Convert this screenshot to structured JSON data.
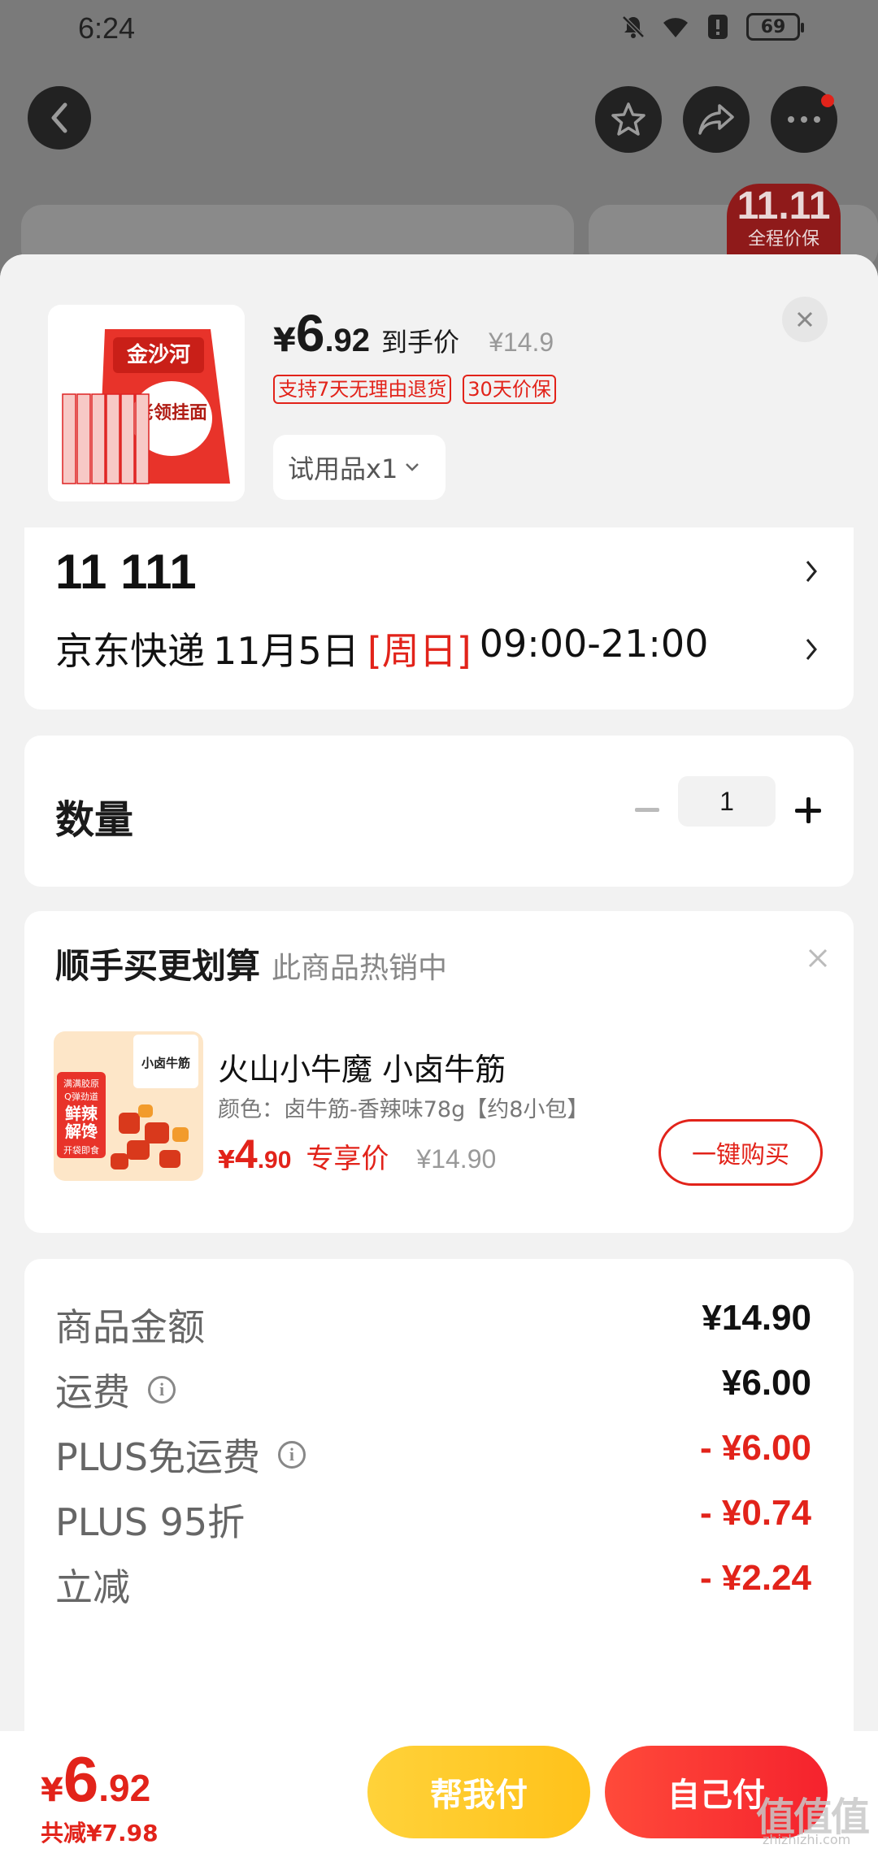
{
  "status_bar": {
    "time": "6:24",
    "battery": "69"
  },
  "background": {
    "banner_big": "11.11",
    "banner_small": "全程价保"
  },
  "product": {
    "price_yen": "¥",
    "price_int": "6",
    "price_dec": ".92",
    "price_label": "到手价",
    "original_price": "¥14.9",
    "tags": [
      "支持7天无理由退货",
      "30天价保"
    ],
    "variant": "试用品x1",
    "image_brand": "金沙河",
    "image_text": "老领挂面"
  },
  "address": {
    "line": "11  111",
    "carrier": "京东快递",
    "date": "11月5日",
    "day": "[周日]",
    "time_window": "09:00-21:00"
  },
  "quantity": {
    "label": "数量",
    "value": "1",
    "minus": "−",
    "plus": "+"
  },
  "upsell": {
    "title": "顺手买更划算",
    "subtitle": "此商品热销中",
    "name": "火山小牛魔 小卤牛筋",
    "spec": "颜色：卤牛筋-香辣味78g【约8小包】",
    "price_yen": "¥",
    "price_int": "4",
    "price_dec": ".90",
    "price_label": "专享价",
    "original_price": "¥14.90",
    "buy_button": "一键购买",
    "image_label": "小卤牛筋",
    "image_tags": [
      "满满胶原",
      "Q弹劲道",
      "鲜辣",
      "解馋",
      "开袋即食"
    ]
  },
  "summary": {
    "rows": [
      {
        "label": "商品金额",
        "value": "¥14.90",
        "info": false,
        "red": false
      },
      {
        "label": "运费",
        "value": "¥6.00",
        "info": true,
        "red": false
      },
      {
        "label": "PLUS免运费",
        "value": "- ¥6.00",
        "info": true,
        "red": true
      },
      {
        "label": "PLUS 95折",
        "value": "- ¥0.74",
        "info": false,
        "red": true
      },
      {
        "label": "立减",
        "value": "- ¥2.24",
        "info": false,
        "red": true
      }
    ]
  },
  "bottom": {
    "total_yen": "¥",
    "total_int": "6",
    "total_dec": ".92",
    "saved": "共减¥7.98",
    "help_pay": "帮我付",
    "self_pay": "自己付"
  },
  "watermark": {
    "main": "值值值",
    "sub": "zhizhizhi.com"
  },
  "colors": {
    "accent_red": "#e2231a",
    "help_yellow": "#ffc21a",
    "sheet_bg": "#f2f2f2"
  },
  "icons": [
    "back-icon",
    "star-icon",
    "share-icon",
    "more-icon",
    "close-icon",
    "chevron-right-icon",
    "chevron-down-icon",
    "info-icon",
    "minus-icon",
    "plus-icon",
    "mute-icon",
    "wifi-icon",
    "alert-icon",
    "battery-icon"
  ]
}
